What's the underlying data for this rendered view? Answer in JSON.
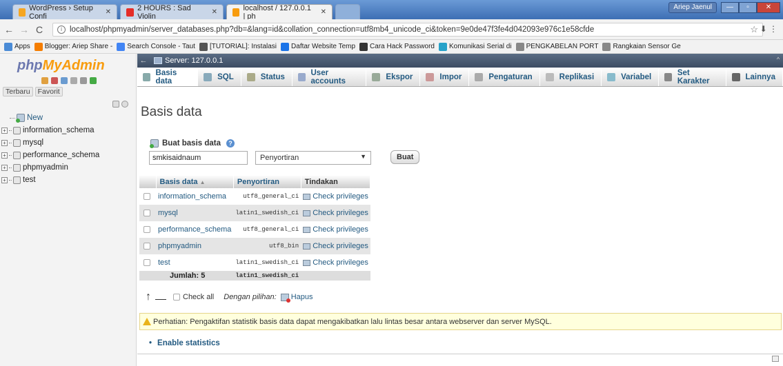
{
  "browser": {
    "tabs": [
      {
        "label": "WordPress › Setup Confi",
        "icon": "wordpress-icon",
        "color": "#f5a623"
      },
      {
        "label": "2 HOURS : Sad Violin",
        "icon": "youtube-icon",
        "color": "#e52d27"
      },
      {
        "label": "localhost / 127.0.0.1 | ph",
        "icon": "phpmyadmin-icon",
        "color": "#f89c0e"
      }
    ],
    "user_badge": "Ariep Jaenul",
    "url": "localhost/phpmyadmin/server_databases.php?db=&lang=id&collation_connection=utf8mb4_unicode_ci&token=9e0de47f3fe4d042093e976c1e58cfde",
    "bookmarks": [
      {
        "label": "Apps",
        "color": "#4a8bd6"
      },
      {
        "label": "Blogger: Ariep Share -",
        "color": "#f57d00"
      },
      {
        "label": "Search Console - Taut",
        "color": "#4285f4"
      },
      {
        "label": "[TUTORIAL]: Instalasi",
        "color": "#555555"
      },
      {
        "label": "Daftar Website Temp",
        "color": "#1a73e8"
      },
      {
        "label": "Cara Hack Password",
        "color": "#333333"
      },
      {
        "label": "Komunikasi Serial di",
        "color": "#27a2c9"
      },
      {
        "label": "PENGKABELAN PORT",
        "color": "#888888"
      },
      {
        "label": "Rangkaian Sensor Ge",
        "color": "#888888"
      }
    ]
  },
  "sidebar": {
    "logo_a": "php",
    "logo_b": "MyAdmin",
    "tab_recent": "Terbaru",
    "tab_favorite": "Favorit",
    "new_label": "New",
    "databases": [
      "information_schema",
      "mysql",
      "performance_schema",
      "phpmyadmin",
      "test"
    ]
  },
  "server": {
    "label": "Server: 127.0.0.1"
  },
  "menu": [
    {
      "label": "Basis data",
      "icon": "database-icon",
      "color": "#8aa"
    },
    {
      "label": "SQL",
      "icon": "sql-icon",
      "color": "#8ab"
    },
    {
      "label": "Status",
      "icon": "status-icon",
      "color": "#aa8"
    },
    {
      "label": "User accounts",
      "icon": "user-accounts-icon",
      "color": "#9ac"
    },
    {
      "label": "Ekspor",
      "icon": "export-icon",
      "color": "#9a9"
    },
    {
      "label": "Impor",
      "icon": "import-icon",
      "color": "#c99"
    },
    {
      "label": "Pengaturan",
      "icon": "settings-icon",
      "color": "#aaa"
    },
    {
      "label": "Replikasi",
      "icon": "replication-icon",
      "color": "#bbb"
    },
    {
      "label": "Variabel",
      "icon": "variables-icon",
      "color": "#8bc"
    },
    {
      "label": "Set Karakter",
      "icon": "charset-icon",
      "color": "#888"
    },
    {
      "label": "Lainnya",
      "icon": "more-icon",
      "color": "#666"
    }
  ],
  "page": {
    "title": "Basis data",
    "create_label": "Buat basis data",
    "db_name_value": "smkisaidnaum",
    "collation_placeholder": "Penyortiran",
    "create_button": "Buat"
  },
  "table": {
    "headers": [
      "Basis data",
      "Penyortiran",
      "Tindakan"
    ],
    "rows": [
      {
        "name": "information_schema",
        "collation": "utf8_general_ci",
        "action": "Check privileges"
      },
      {
        "name": "mysql",
        "collation": "latin1_swedish_ci",
        "action": "Check privileges"
      },
      {
        "name": "performance_schema",
        "collation": "utf8_general_ci",
        "action": "Check privileges"
      },
      {
        "name": "phpmyadmin",
        "collation": "utf8_bin",
        "action": "Check privileges"
      },
      {
        "name": "test",
        "collation": "latin1_swedish_ci",
        "action": "Check privileges"
      }
    ],
    "footer_label": "Jumlah: 5",
    "footer_collation": "latin1_swedish_ci"
  },
  "bulk": {
    "check_all": "Check all",
    "with_selected": "Dengan pilihan:",
    "delete": "Hapus"
  },
  "notice": "Perhatian: Pengaktifan statistik basis data dapat mengakibatkan lalu lintas besar antara webserver dan server MySQL.",
  "enable_stats": "Enable statistics"
}
